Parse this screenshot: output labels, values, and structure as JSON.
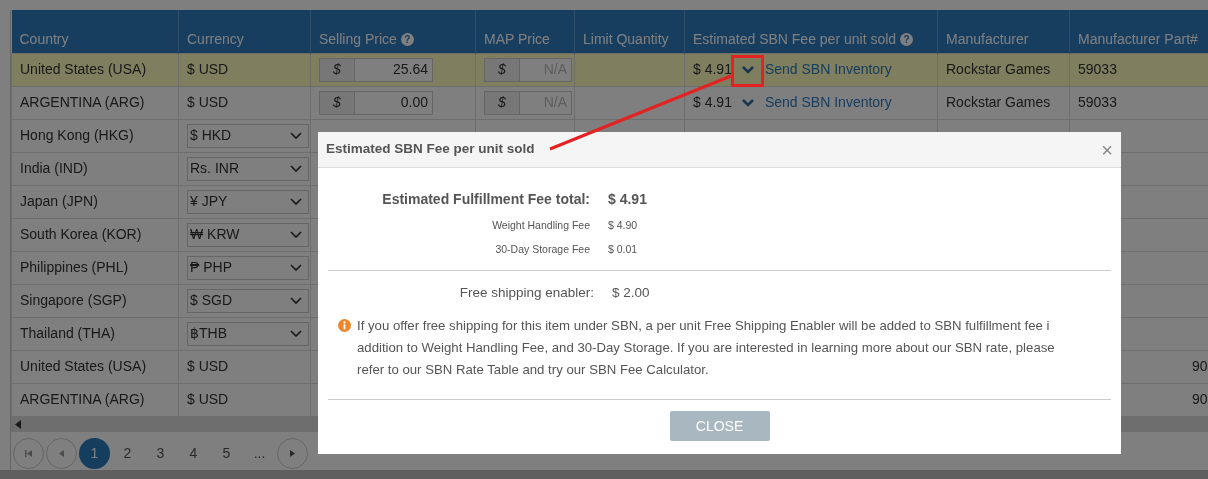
{
  "table": {
    "columns": [
      {
        "label": "Country"
      },
      {
        "label": "Currency"
      },
      {
        "label": "Selling Price",
        "help": "?"
      },
      {
        "label": "MAP Price"
      },
      {
        "label": "Limit Quantity"
      },
      {
        "label": "Estimated SBN Fee per unit sold",
        "help": "?"
      },
      {
        "label": "Manufacturer"
      },
      {
        "label": "Manufacturer Part#"
      }
    ],
    "rows": [
      {
        "selected": true,
        "country": "United States (USA)",
        "currency": {
          "kind": "text",
          "text": "$ USD"
        },
        "selling_price": {
          "prefix": "$",
          "value": "25.64"
        },
        "map_price": {
          "prefix": "$",
          "placeholder": "N/A"
        },
        "fee": "$ 4.91",
        "link": "Send SBN Inventory",
        "manufacturer": "Rockstar Games",
        "part": "59033"
      },
      {
        "selected": false,
        "country": "ARGENTINA (ARG)",
        "currency": {
          "kind": "text",
          "text": "$ USD"
        },
        "selling_price": {
          "prefix": "$",
          "value": "0.00"
        },
        "map_price": {
          "prefix": "$",
          "placeholder": "N/A"
        },
        "fee": "$ 4.91",
        "link": "Send SBN Inventory",
        "manufacturer": "Rockstar Games",
        "part": "59033"
      },
      {
        "selected": false,
        "country": "Hong Kong (HKG)",
        "currency": {
          "kind": "select",
          "text": "$ HKD"
        }
      },
      {
        "selected": false,
        "country": "India (IND)",
        "currency": {
          "kind": "select",
          "text": "Rs. INR"
        }
      },
      {
        "selected": false,
        "country": "Japan (JPN)",
        "currency": {
          "kind": "select",
          "text": "¥ JPY"
        }
      },
      {
        "selected": false,
        "country": "South Korea (KOR)",
        "currency": {
          "kind": "select",
          "text": "₩ KRW"
        }
      },
      {
        "selected": false,
        "country": "Philippines (PHL)",
        "currency": {
          "kind": "select",
          "text": "₱ PHP"
        }
      },
      {
        "selected": false,
        "country": "Singapore (SGP)",
        "currency": {
          "kind": "select",
          "text": "$ SGD"
        }
      },
      {
        "selected": false,
        "country": "Thailand (THA)",
        "currency": {
          "kind": "select",
          "text": "฿THB"
        }
      },
      {
        "selected": false,
        "country": "United States (USA)",
        "currency": {
          "kind": "text",
          "text": "$ USD"
        },
        "part": "90"
      },
      {
        "selected": false,
        "country": "ARGENTINA (ARG)",
        "currency": {
          "kind": "text",
          "text": "$ USD"
        },
        "part": "90"
      }
    ]
  },
  "pagination": {
    "pages": [
      {
        "label": "1",
        "selected": true
      },
      {
        "label": "2",
        "selected": false
      },
      {
        "label": "3",
        "selected": false
      },
      {
        "label": "4",
        "selected": false
      },
      {
        "label": "5",
        "selected": false
      }
    ],
    "ellipsis": "..."
  },
  "modal": {
    "title": "Estimated SBN Fee per unit sold",
    "close": "×",
    "fees": [
      {
        "kind": "total",
        "label": "Estimated Fulfillment Fee total:",
        "value": "$ 4.91"
      },
      {
        "kind": "item",
        "label": "Weight Handling Fee",
        "value": "$ 4.90"
      },
      {
        "kind": "item",
        "label": "30-Day Storage Fee",
        "value": "$ 0.01"
      }
    ],
    "enabler": {
      "label": "Free shipping enabler:",
      "value": "$ 2.00"
    },
    "note": [
      {
        "kind": "text",
        "text": "If you offer free shipping for this item under SBN, a per unit Free Shipping Enabler will be added to SBN fulfillment fee i\naddition to Weight Handling Fee, and 30-Day Storage. If you are interested in learning more about our SBN rate, please\nrefer to our "
      },
      {
        "kind": "link",
        "text": "SBN Rate Table"
      },
      {
        "kind": "text",
        "text": " and try our "
      },
      {
        "kind": "link",
        "text": "SBN Fee Calculator"
      },
      {
        "kind": "text",
        "text": "."
      }
    ],
    "button": "CLOSE"
  }
}
